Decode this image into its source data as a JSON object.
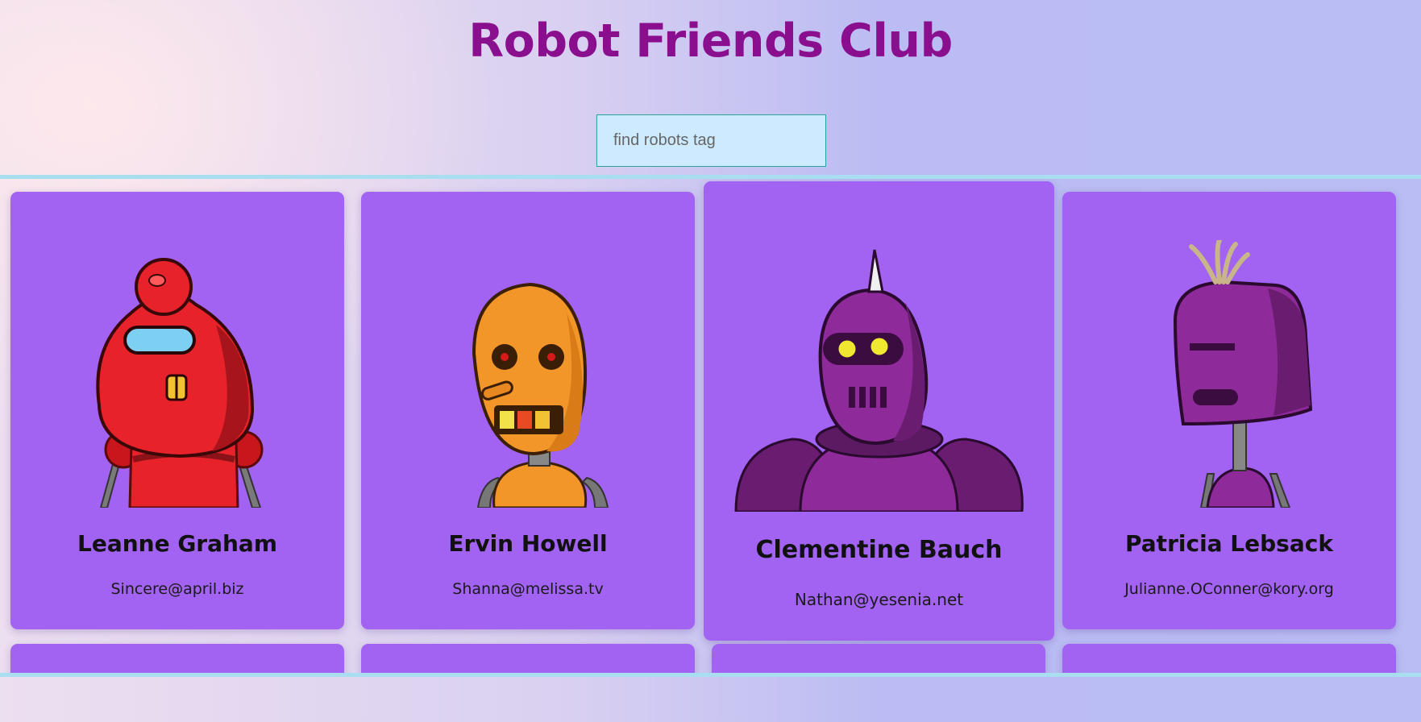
{
  "header": {
    "title": "Robot Friends Club"
  },
  "search": {
    "placeholder": "find robots tag",
    "value": ""
  },
  "robots": [
    {
      "name": "Leanne Graham",
      "email": "Sincere@april.biz",
      "color": "#e8222a",
      "icon": "red-robot-icon"
    },
    {
      "name": "Ervin Howell",
      "email": "Shanna@melissa.tv",
      "color": "#f3962a",
      "icon": "orange-robot-icon"
    },
    {
      "name": "Clementine Bauch",
      "email": "Nathan@yesenia.net",
      "color": "#8e2a9a",
      "icon": "purple-robot-icon"
    },
    {
      "name": "Patricia Lebsack",
      "email": "Julianne.OConner@kory.org",
      "color": "#8e2a9a",
      "icon": "helmet-robot-icon"
    }
  ],
  "colors": {
    "card": "#a262f2",
    "title": "#8a0f8e",
    "search_bg": "#cdeafe",
    "divider": "#a9def0"
  }
}
